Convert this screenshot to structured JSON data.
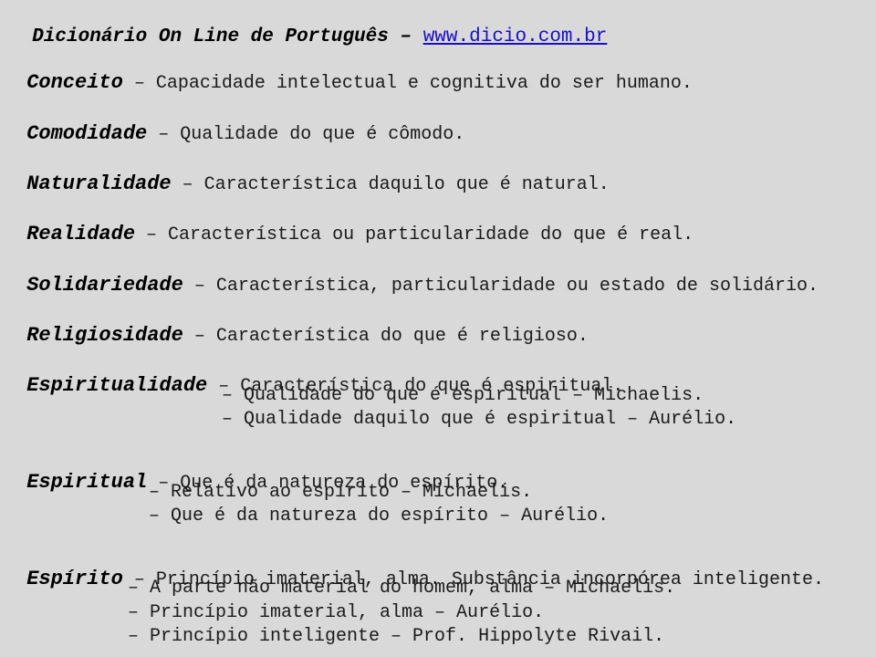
{
  "header": {
    "title": "Dicionário On Line de Português – ",
    "link": "www.dicio.com.br"
  },
  "entries": [
    {
      "term": "Conceito",
      "definition": " – Capacidade intelectual e cognitiva do ser humano."
    },
    {
      "term": "Comodidade",
      "definition": " – Qualidade do que é cômodo."
    },
    {
      "term": "Naturalidade",
      "definition": " – Característica daquilo que é natural."
    },
    {
      "term": "Realidade",
      "definition": " – Característica ou particularidade do que é real."
    },
    {
      "term": "Solidariedade",
      "definition": " – Característica, particularidade ou estado de solidário."
    },
    {
      "term": "Religiosidade",
      "definition": " – Característica do que é religioso."
    },
    {
      "term": "Espiritualidade",
      "definition": " – Característica do que é espiritual.",
      "sub": [
        "– Qualidade do que é espiritual – Michaelis.",
        "– Qualidade daquilo que é espiritual – Aurélio."
      ]
    },
    {
      "term": "Espiritual",
      "definition": " – Que é da natureza do espírito.",
      "sub": [
        "– Relativo ao espírito – Michaelis.",
        "– Que é da natureza do espírito – Aurélio."
      ]
    },
    {
      "term": "Espírito",
      "definition": " – Princípio imaterial, alma. Substância incorpórea inteligente.",
      "sub": [
        "– A parte não material do homem, alma – Michaelis.",
        "– Princípio imaterial, alma – Aurélio.",
        "– Princípio inteligente – Prof. Hippolyte Rivail."
      ]
    }
  ]
}
